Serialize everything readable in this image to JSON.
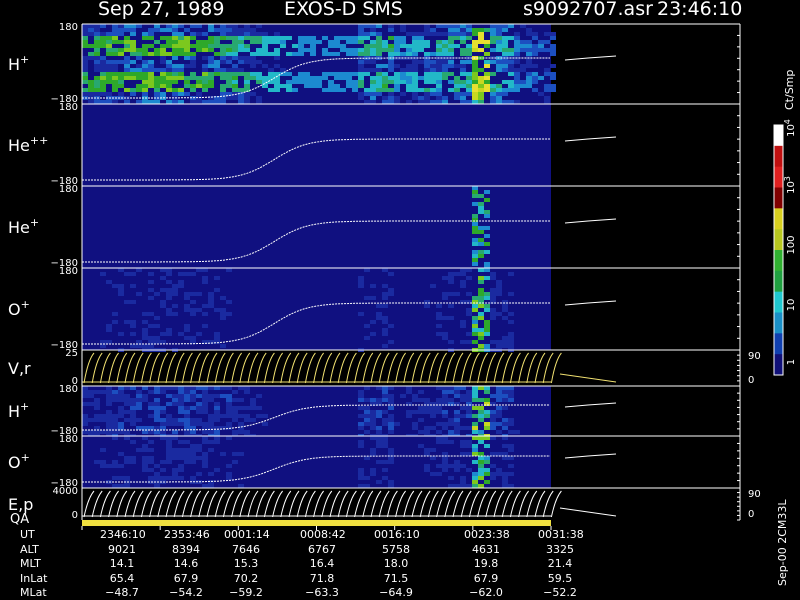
{
  "header": {
    "date": "Sep 27, 1989",
    "instrument": "EXOS-D SMS",
    "file": "s9092707.asr",
    "time": "23:46:10"
  },
  "panels": [
    {
      "id": "h-plus",
      "label": "H",
      "sup": "+",
      "ticks": [
        "180",
        "−180"
      ],
      "intensity": 0.55
    },
    {
      "id": "he-pp",
      "label": "He",
      "sup": "++",
      "ticks": [
        "180",
        "−180"
      ],
      "intensity": 0.0
    },
    {
      "id": "he-plus",
      "label": "He",
      "sup": "+",
      "ticks": [
        "180",
        "−180"
      ],
      "intensity": 0.12
    },
    {
      "id": "o-plus",
      "label": "O",
      "sup": "+",
      "ticks": [
        "180",
        "−180"
      ],
      "intensity": 0.22
    },
    {
      "id": "vr",
      "label": "V,r",
      "sup": "",
      "ticks": [
        "25",
        "0"
      ],
      "right_ticks": [
        "90",
        "0"
      ]
    },
    {
      "id": "h-plus-2",
      "label": "H",
      "sup": "+",
      "ticks": [
        "180",
        "−180"
      ],
      "intensity": 0.4
    },
    {
      "id": "o-plus-2",
      "label": "O",
      "sup": "+",
      "ticks": [
        "180",
        "−180"
      ],
      "intensity": 0.25
    },
    {
      "id": "ep",
      "label": "E,p",
      "sup": "",
      "ticks": [
        "4000",
        "0"
      ],
      "right_ticks": [
        "90",
        "0"
      ]
    }
  ],
  "qa_label": "QA",
  "colorbar": {
    "title": "Ct/Smp",
    "labels": [
      {
        "base": "10",
        "exp": "4"
      },
      {
        "base": "10",
        "exp": "3"
      },
      {
        "base": "100",
        "exp": ""
      },
      {
        "base": "10",
        "exp": ""
      },
      {
        "base": "1",
        "exp": ""
      }
    ]
  },
  "footer": {
    "rows": [
      {
        "name": "UT",
        "values": [
          "2346:10",
          "2353:46",
          "0001:14",
          "0008:42",
          "0016:10",
          "0023:38",
          "0031:38"
        ]
      },
      {
        "name": "ALT",
        "values": [
          "9021",
          "8394",
          "7646",
          "6767",
          "5758",
          "4631",
          "3325"
        ]
      },
      {
        "name": "MLT",
        "values": [
          "14.1",
          "14.6",
          "15.3",
          "16.4",
          "18.0",
          "19.8",
          "21.4"
        ]
      },
      {
        "name": "InLat",
        "values": [
          "65.4",
          "67.9",
          "70.2",
          "71.8",
          "71.5",
          "67.9",
          "59.5"
        ]
      },
      {
        "name": "MLat",
        "values": [
          "−48.7",
          "−54.2",
          "−59.2",
          "−63.3",
          "−64.9",
          "−62.0",
          "−52.2"
        ]
      }
    ]
  },
  "side_label": "Sep-00 2CM33L"
}
